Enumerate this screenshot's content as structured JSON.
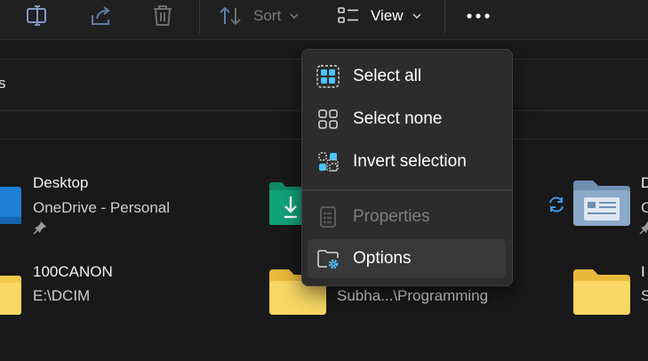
{
  "toolbar": {
    "sort_label": "Sort",
    "view_label": "View",
    "icons": [
      "rename-icon",
      "share-icon",
      "delete-icon",
      "sort-icon",
      "view-icon",
      "more-icon"
    ]
  },
  "addressbar": {
    "text": "s"
  },
  "items": [
    {
      "name": "Desktop",
      "sub": "OneDrive - Personal",
      "pinned": true
    },
    {
      "name": "100CANON",
      "sub": "E:\\DCIM",
      "pinned": false
    },
    {
      "name": "",
      "sub": "Subha...\\Programming",
      "pinned": false
    },
    {
      "name": "D",
      "sub": "C",
      "pinned": true
    },
    {
      "name": "I",
      "sub": "S",
      "pinned": false
    }
  ],
  "menu": {
    "items": [
      {
        "label": "Select all",
        "icon": "select-all-icon",
        "enabled": true
      },
      {
        "label": "Select none",
        "icon": "select-none-icon",
        "enabled": true
      },
      {
        "label": "Invert selection",
        "icon": "invert-selection-icon",
        "enabled": true
      },
      {
        "label": "Properties",
        "icon": "properties-icon",
        "enabled": false
      },
      {
        "label": "Options",
        "icon": "folder-options-icon",
        "enabled": true,
        "hovered": true
      }
    ]
  },
  "colors": {
    "accent": "#4cc2ff",
    "folder": "#f2c94c",
    "green_folder": "#12a27a",
    "menu_bg": "#2c2c2c",
    "bg": "#191919"
  }
}
